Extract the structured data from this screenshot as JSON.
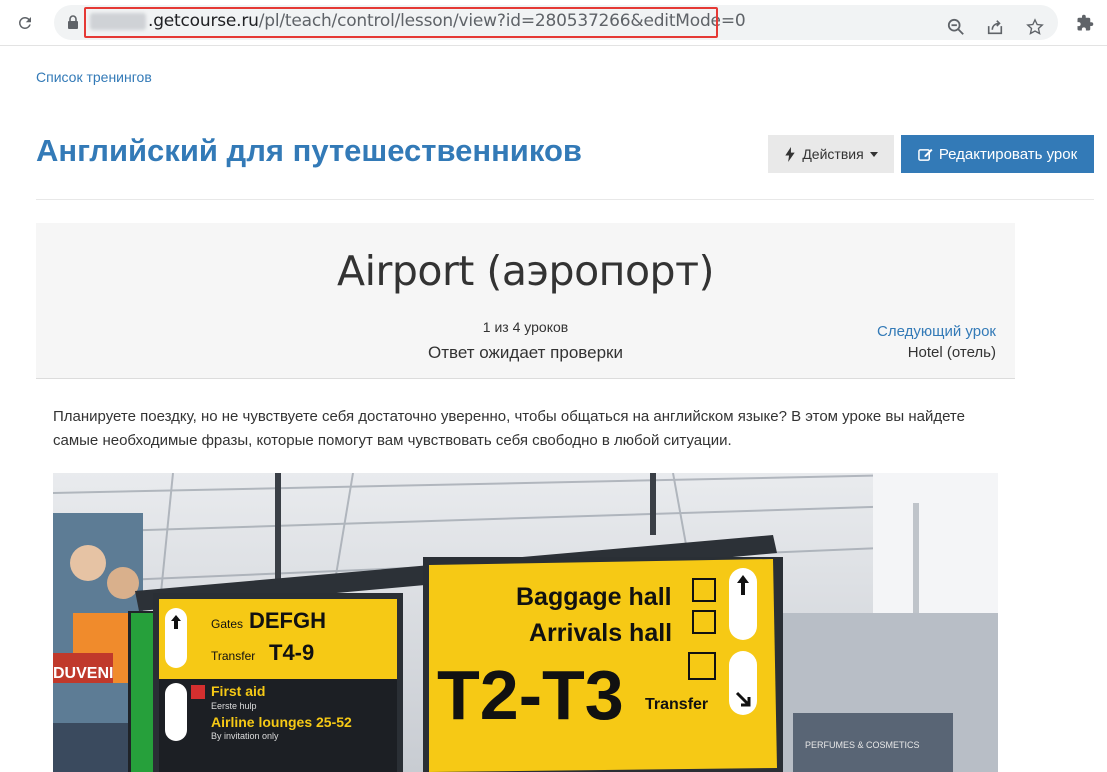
{
  "browser": {
    "url_domain": ".getcourse.ru",
    "url_path": "/pl/teach/control/lesson/view?id=280537266&editMode=0"
  },
  "page": {
    "breadcrumb": "Список тренингов",
    "title": "Английский для путешественников",
    "actions_label": "Действия",
    "edit_label": "Редактировать урок"
  },
  "lesson": {
    "title": "Airport (аэропорт)",
    "count": "1 из 4 уроков",
    "status": "Ответ ожидает проверки",
    "next_link": "Следующий урок",
    "next_name": "Hotel (отель)",
    "intro": "Планируете поездку, но не чувствуете себя достаточно уверенно, чтобы общаться на английском языке? В этом уроке вы найдете самые необходимые фразы, которые помогут вам чувствовать себя свободно в любой ситуации."
  },
  "image": {
    "sign_left": {
      "gates": "Gates",
      "gates_code": "DEFGH",
      "transfer": "Transfer",
      "transfer_code": "T4-9",
      "first_aid": "First aid",
      "first_aid_sub": "Eerste hulp",
      "lounges": "Airline lounges 25-52",
      "lounges_sub": "By invitation only"
    },
    "sign_right": {
      "baggage": "Baggage hall",
      "arrivals": "Arrivals hall",
      "terminals": "T2-T3",
      "transfer": "Transfer"
    },
    "shop_left": "DUVENI",
    "shop_right": "PERFUMES & COSMETICS"
  },
  "colors": {
    "link": "#337ab7",
    "sign_yellow": "#f6c915",
    "highlight": "#e53935"
  }
}
